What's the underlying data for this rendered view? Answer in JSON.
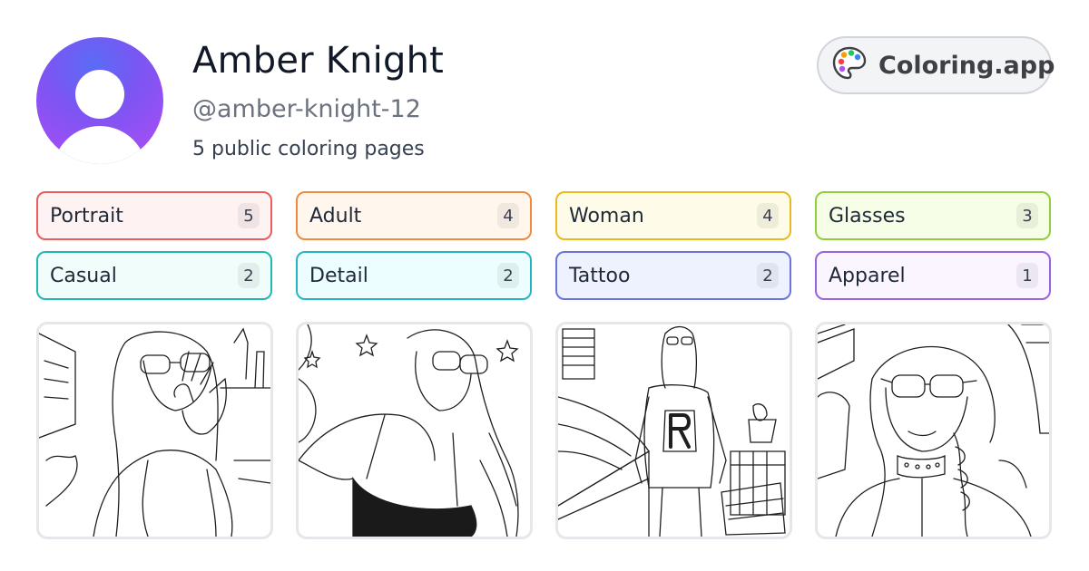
{
  "profile": {
    "name": "Amber Knight",
    "handle": "@amber-knight-12",
    "page_count": "5 public coloring pages",
    "avatar_icon": "user-avatar-icon"
  },
  "brand": {
    "label": "Coloring.app",
    "icon": "palette-icon",
    "palette_colors": [
      "#ef4444",
      "#f59e0b",
      "#22c55e",
      "#3b82f6",
      "#a855f7"
    ]
  },
  "tags": [
    {
      "name": "Portrait",
      "count": "5",
      "border": "#e85d5d",
      "bg": "#fef2f2"
    },
    {
      "name": "Adult",
      "count": "4",
      "border": "#f08a3c",
      "bg": "#fff7ed"
    },
    {
      "name": "Woman",
      "count": "4",
      "border": "#e8b923",
      "bg": "#fefce8"
    },
    {
      "name": "Glasses",
      "count": "3",
      "border": "#8fcf3c",
      "bg": "#f7fee7"
    },
    {
      "name": "Casual",
      "count": "2",
      "border": "#1fb8ad",
      "bg": "#f0fdfa"
    },
    {
      "name": "Detail",
      "count": "2",
      "border": "#28b3c4",
      "bg": "#ecfeff"
    },
    {
      "name": "Tattoo",
      "count": "2",
      "border": "#6a73e0",
      "bg": "#eef2ff"
    },
    {
      "name": "Apparel",
      "count": "1",
      "border": "#9b62e0",
      "bg": "#faf5ff"
    }
  ],
  "thumbnails": [
    {
      "subject": "woman-blowing-kiss-sketch"
    },
    {
      "subject": "woman-selfie-bedroom-sketch"
    },
    {
      "subject": "woman-letter-sweater-sketch"
    },
    {
      "subject": "woman-car-portrait-sketch"
    }
  ]
}
